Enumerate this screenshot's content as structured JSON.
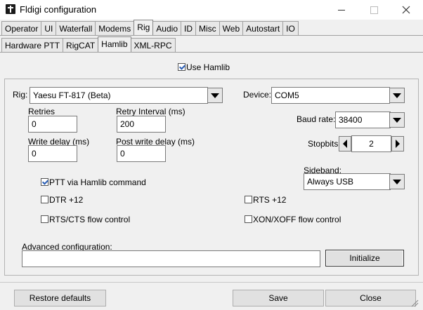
{
  "window": {
    "title": "Fldigi configuration"
  },
  "main_tabs": [
    "Operator",
    "UI",
    "Waterfall",
    "Modems",
    "Rig",
    "Audio",
    "ID",
    "Misc",
    "Web",
    "Autostart",
    "IO"
  ],
  "main_tabs_active": "Rig",
  "rig_tabs": [
    "Hardware PTT",
    "RigCAT",
    "Hamlib",
    "XML-RPC"
  ],
  "rig_tabs_active": "Hamlib",
  "hamlib": {
    "use_hamlib_label": "Use Hamlib",
    "use_hamlib_checked": true,
    "rig_label": "Rig:",
    "rig_value": "Yaesu FT-817  (Beta)",
    "device_label": "Device:",
    "device_value": "COM5",
    "retries_label": "Retries",
    "retries_value": "0",
    "retry_interval_label": "Retry Interval (ms)",
    "retry_interval_value": "200",
    "write_delay_label": "Write delay (ms)",
    "write_delay_value": "0",
    "post_write_delay_label": "Post write delay (ms)",
    "post_write_delay_value": "0",
    "baud_rate_label": "Baud rate:",
    "baud_rate_value": "38400",
    "stopbits_label": "Stopbits",
    "stopbits_value": "2",
    "sideband_label": "Sideband:",
    "sideband_value": "Always USB",
    "ptt_label": "PTT via Hamlib command",
    "ptt_checked": true,
    "dtr_label": "DTR +12",
    "dtr_checked": false,
    "rts_label": "RTS +12",
    "rts_checked": false,
    "rtscts_label": "RTS/CTS flow control",
    "rtscts_checked": false,
    "xonxoff_label": "XON/XOFF flow control",
    "xonxoff_checked": false,
    "advanced_label": "Advanced configuration:",
    "advanced_value": "",
    "initialize_label": "Initialize"
  },
  "footer": {
    "restore_label": "Restore defaults",
    "save_label": "Save",
    "close_label": "Close"
  }
}
